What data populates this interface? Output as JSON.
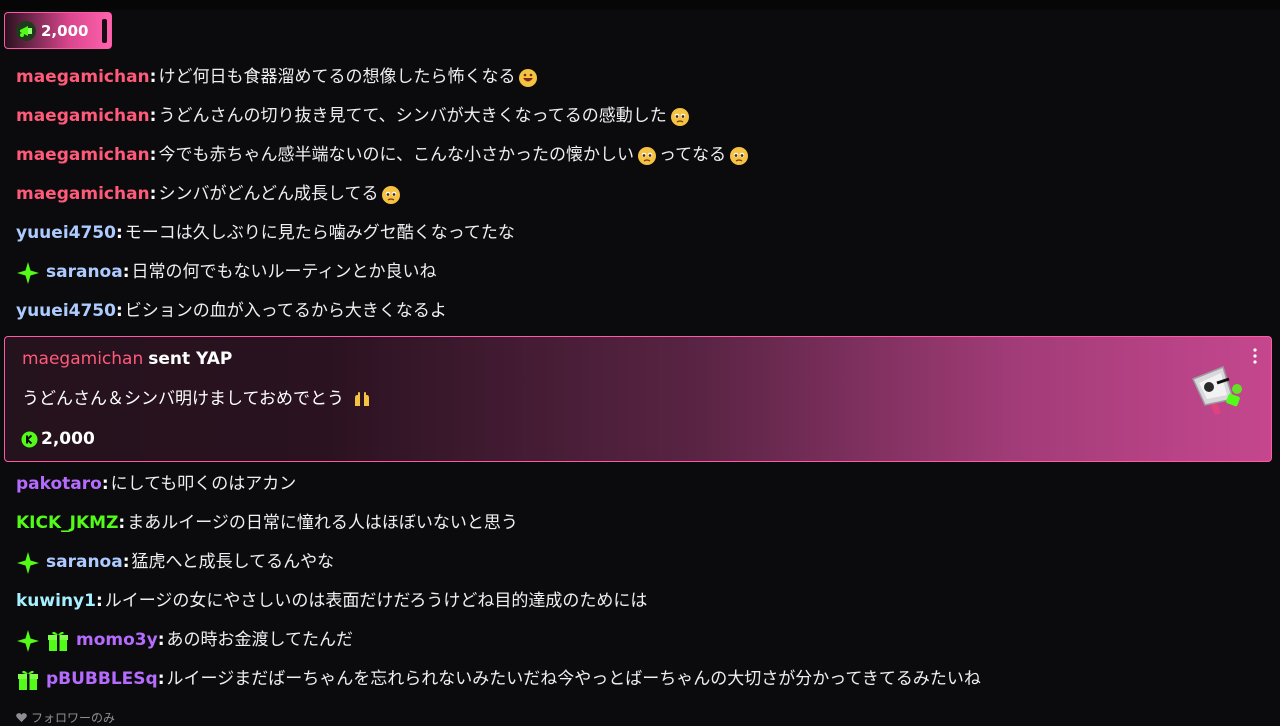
{
  "pinned": {
    "amount": "2,000"
  },
  "colors": {
    "accent": "#ff5aa6",
    "pink_user": "#ff5a7a",
    "blue_user": "#aecbff",
    "purple_user": "#b66bff",
    "green_user": "#53fc18",
    "teal_user": "#a6f0ff"
  },
  "messages_top": [
    {
      "user": "maegamichan",
      "text": "けど何日も食器溜めてるの想像したら怖くなる",
      "color": "#ff5a7a"
    },
    {
      "user": "maegamichan",
      "text": "うどんさんの切り抜き見てて、シンバが大きくなってるの感動した",
      "color": "#ff5a7a"
    },
    {
      "user": "maegamichan",
      "text": "今でも赤ちゃん感半端ないのに、こんな小さかったの懐かしい",
      "text2": "ってなる",
      "color": "#ff5a7a"
    },
    {
      "user": "maegamichan",
      "text": "シンバがどんどん成長してる",
      "color": "#ff5a7a"
    },
    {
      "user": "yuuei4750",
      "text": "モーコは久しぶりに見たら噛みグセ酷くなってたな",
      "color": "#aecbff"
    },
    {
      "user": "saranoa",
      "text": "日常の何でもないルーティンとか良いね",
      "color": "#aecbff"
    },
    {
      "user": "yuuei4750",
      "text": "ビションの血が入ってるから大きくなるよ",
      "color": "#aecbff"
    }
  ],
  "yap": {
    "user": "maegamichan",
    "sent": "sent YAP",
    "text": "うどんさん＆シンバ明けましておめでとう",
    "amount": "2,000"
  },
  "messages_bottom": [
    {
      "user": "pakotaro",
      "text": "にしても叩くのはアカン",
      "color": "#b66bff"
    },
    {
      "user": "KICK_JKMZ",
      "text": "まあルイージの日常に憧れる人はほぼいないと思う",
      "color": "#53fc18"
    },
    {
      "user": "saranoa",
      "text": "猛虎へと成長してるんやな",
      "color": "#aecbff"
    },
    {
      "user": "kuwiny1",
      "text": "ルイージの女にやさしいのは表面だけだろうけどね目的達成のためには",
      "color": "#a6f0ff"
    },
    {
      "user": "momo3y",
      "text": "あの時お金渡してたんだ",
      "color": "#b66bff"
    },
    {
      "user": "pBUBBLESq",
      "text": "ルイージまだばーちゃんを忘れられないみたいだね今やっとばーちゃんの大切さが分かってきてるみたいね",
      "color": "#b66bff"
    }
  ],
  "footer": {
    "text": "フォロワーのみ"
  },
  "icons": {
    "pin": "megaphone-icon",
    "sparkle": "sparkle-badge-icon",
    "gift": "gift-badge-icon",
    "emoji_laugh": "grinning-face-icon",
    "emoji_tear": "pleading-face-icon",
    "emoji_raise": "raised-hands-icon",
    "coin": "kick-coin-icon",
    "more": "kebab-menu-icon",
    "heart": "heart-icon"
  }
}
